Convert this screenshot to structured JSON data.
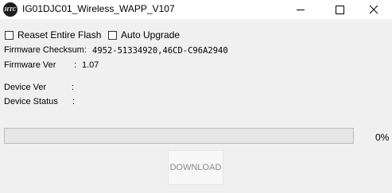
{
  "window": {
    "title": "IG01DJC01_Wireless_WAPP_V107",
    "icon_text": "HTC"
  },
  "options": {
    "reset_flash_label": "Reaset Entire Flash",
    "reset_flash_checked": false,
    "auto_upgrade_label": "Auto Upgrade",
    "auto_upgrade_checked": false
  },
  "firmware": {
    "checksum_label": "Firmware Checksum:",
    "checksum_value": "4952-51334920,46CD-C96A2940",
    "version_label": "Firmware Ver",
    "version_sep": ":",
    "version_value": "1.07"
  },
  "device": {
    "ver_label": "Device Ver",
    "ver_sep": ":",
    "status_label": "Device Status",
    "status_sep": ":"
  },
  "progress": {
    "percent_text": "0%",
    "fraction": 0
  },
  "download_label": "DOWNLOAD",
  "colors": {
    "background": "#f0f0f0",
    "progress_fill": "#06b025",
    "disabled_text": "#8a8a8a"
  }
}
